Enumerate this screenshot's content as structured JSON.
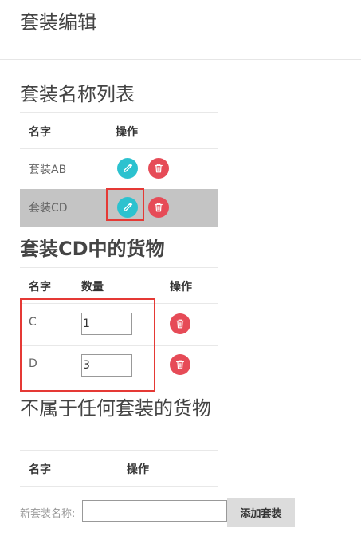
{
  "page": {
    "title": "套装编辑"
  },
  "sets_section": {
    "title": "套装名称列表",
    "headers": {
      "name": "名字",
      "action": "操作"
    },
    "rows": [
      {
        "name": "套装AB"
      },
      {
        "name": "套装CD"
      }
    ]
  },
  "goods_section": {
    "title": "套装CD中的货物",
    "headers": {
      "name": "名字",
      "qty": "数量",
      "action": "操作"
    },
    "rows": [
      {
        "name": "C",
        "qty": "1"
      },
      {
        "name": "D",
        "qty": "3"
      }
    ]
  },
  "other_section": {
    "title": "不属于任何套装的货物",
    "headers": {
      "name": "名字",
      "action": "操作"
    }
  },
  "footer": {
    "label": "新套装名称:",
    "input_value": "",
    "add_button": "添加套装"
  },
  "colors": {
    "edit": "#2cc2cf",
    "delete": "#e64b57",
    "selected_row": "#c4c4c4",
    "highlight": "#e53935"
  },
  "icons": {
    "edit": "pencil-icon",
    "delete": "trash-icon"
  }
}
